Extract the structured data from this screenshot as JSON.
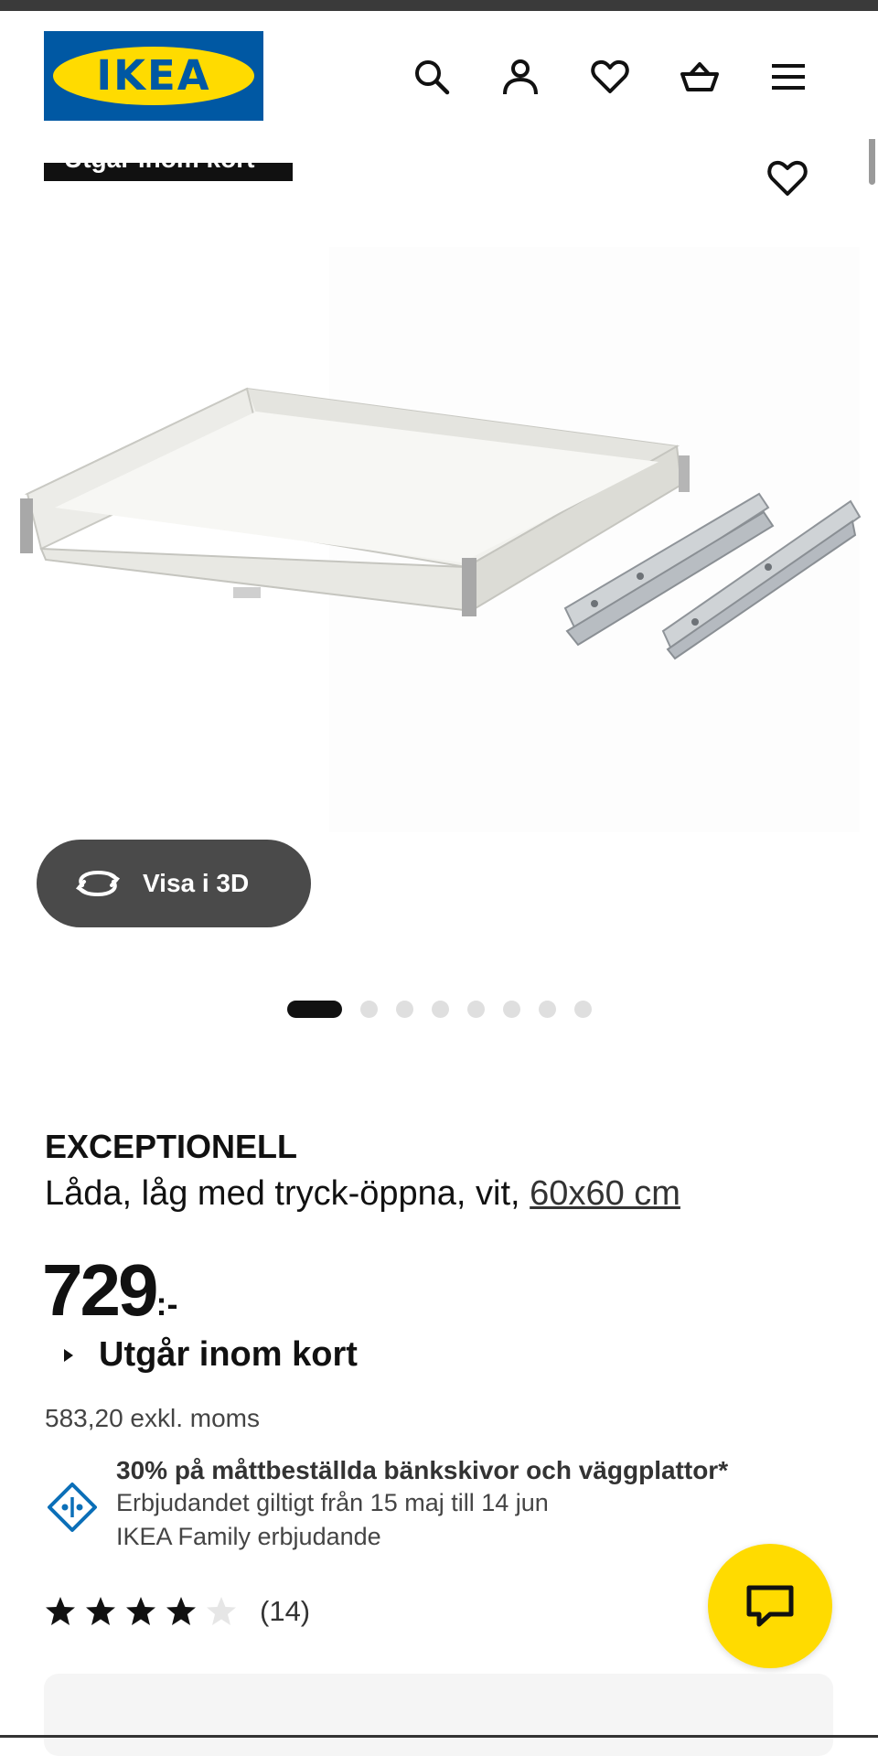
{
  "header": {
    "logo_text": "IKEA",
    "icons": [
      "search-icon",
      "account-icon",
      "heart-icon",
      "cart-icon",
      "menu-icon"
    ]
  },
  "badge": {
    "text": "Utgår inom kort"
  },
  "gallery": {
    "view_3d_label": "Visa i 3D",
    "image_count": 8,
    "active_index": 1
  },
  "product": {
    "name": "EXCEPTIONELL",
    "description": "Låda, låg med tryck-öppna, vit,",
    "size_link": "60x60 cm",
    "price_integer": "729",
    "price_suffix": ":-",
    "availability": "Utgår inom kort",
    "price_excl_vat": "583,20 exkl. moms"
  },
  "offer": {
    "title": "30% på måttbeställda bänkskivor och väggplattor*",
    "validity": "Erbjudandet giltigt från 15 maj till 14 jun",
    "program": "IKEA Family erbjudande"
  },
  "rating": {
    "stars": 4,
    "max_stars": 5,
    "review_count": "(14)"
  },
  "colors": {
    "ikea_blue": "#0058a3",
    "ikea_yellow": "#ffdb00",
    "button_gray": "#4a4a4a",
    "offer_icon_blue": "#0b6fb8"
  }
}
